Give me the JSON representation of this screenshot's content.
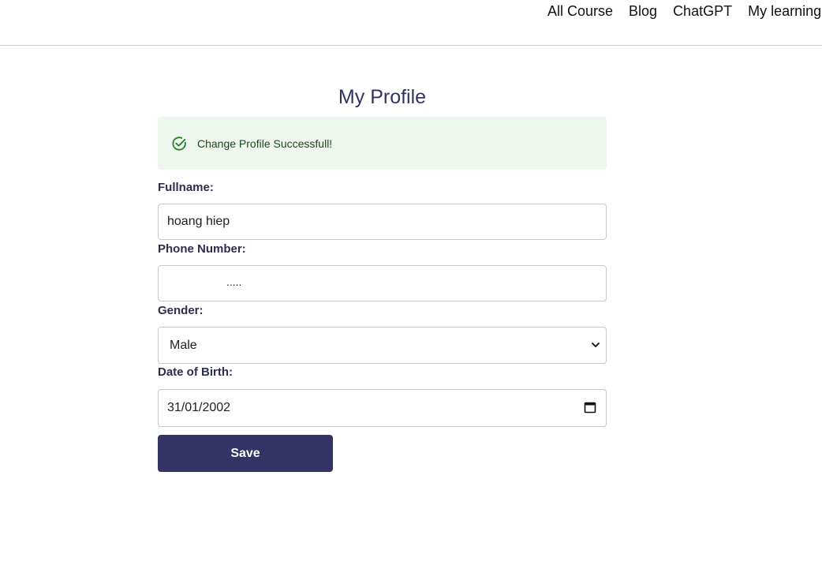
{
  "nav": {
    "items": [
      "All Course",
      "Blog",
      "ChatGPT",
      "My learning"
    ]
  },
  "page": {
    "title": "My Profile"
  },
  "alert": {
    "icon": "check-circle-icon",
    "message": "Change Profile Successfull!",
    "color": "#2e7d32",
    "background": "#edf7ed"
  },
  "form": {
    "fullname_label": "Fullname:",
    "fullname_value": "hoang hiep",
    "phone_label": "Phone Number:",
    "phone_value": ".....",
    "gender_label": "Gender:",
    "gender_value": "Male",
    "dob_label": "Date of Birth:",
    "dob_value": "31/01/2002",
    "save_label": "Save"
  },
  "colors": {
    "primary": "#333366"
  }
}
